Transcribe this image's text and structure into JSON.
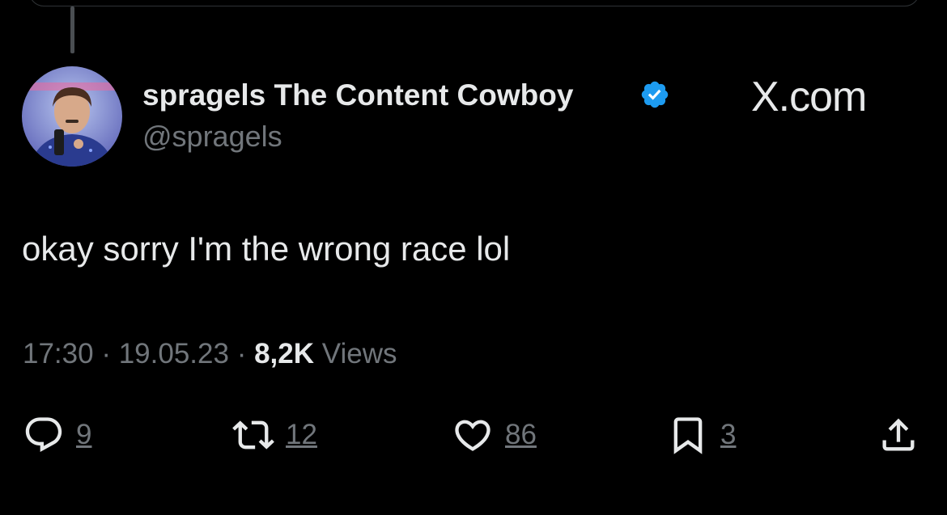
{
  "tweet": {
    "display_name": "spragels The Content Cowboy",
    "handle": "@spragels",
    "brand": "X.com",
    "text": "okay sorry I'm the wrong race lol",
    "time": "17:30",
    "date": "19.05.23",
    "views_count": "8,2K",
    "views_label": "Views"
  },
  "actions": {
    "replies": "9",
    "retweets": "12",
    "likes": "86",
    "bookmarks": "3"
  },
  "colors": {
    "background": "#000000",
    "primary_text": "#e7e9ea",
    "secondary_text": "#71767b",
    "verified": "#1d9bf0"
  },
  "icons": [
    "verified-badge-icon",
    "reply-icon",
    "retweet-icon",
    "like-icon",
    "bookmark-icon",
    "share-icon"
  ]
}
